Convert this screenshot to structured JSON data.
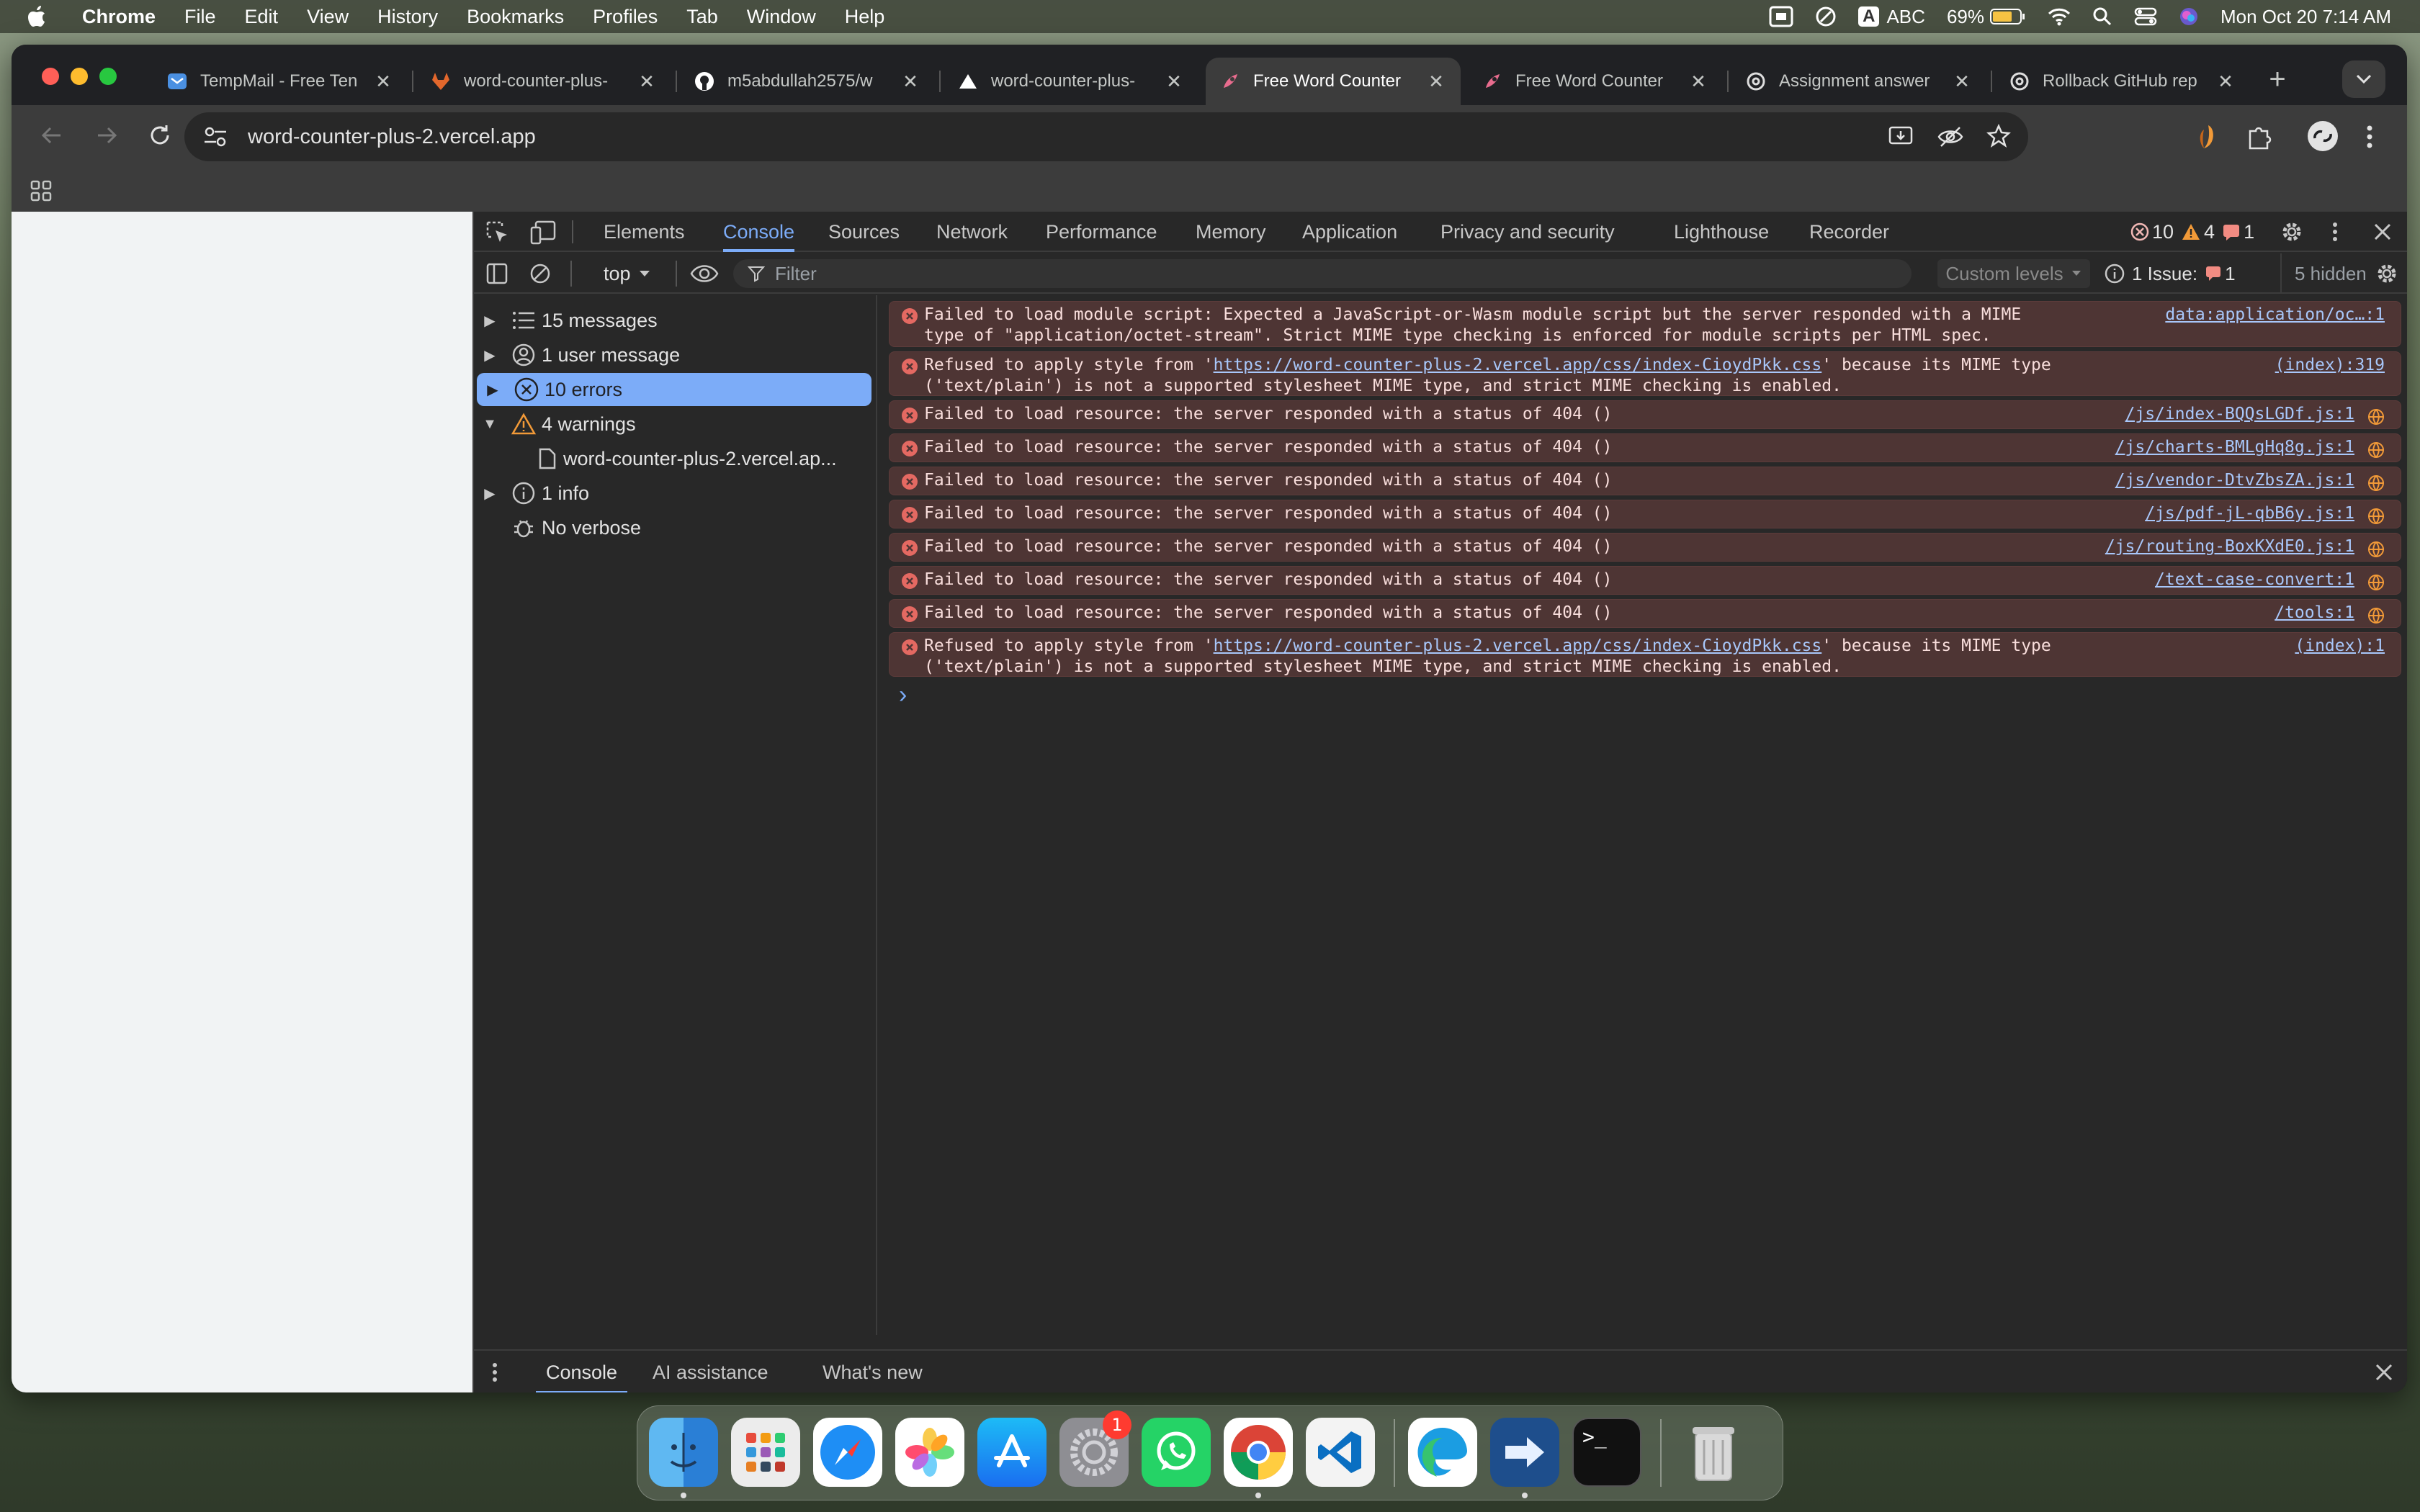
{
  "menubar": {
    "app_name": "Chrome",
    "items": [
      "File",
      "Edit",
      "View",
      "History",
      "Bookmarks",
      "Profiles",
      "Tab",
      "Window",
      "Help"
    ],
    "input_source": "ABC",
    "input_letter": "A",
    "battery": "69%",
    "datetime": "Mon Oct 20  7:14 AM"
  },
  "tabs": [
    {
      "title": "TempMail - Free Ten",
      "icon": "mail-icon",
      "color": "#4a90e2"
    },
    {
      "title": "word-counter-plus-",
      "icon": "gitlab-icon",
      "color": "#e2672c"
    },
    {
      "title": "m5abdullah2575/w",
      "icon": "github-icon",
      "color": "#ffffff"
    },
    {
      "title": "word-counter-plus-",
      "icon": "vercel-icon",
      "color": "#ffffff"
    },
    {
      "title": "Free Word Counter",
      "icon": "rocket-icon",
      "color": "#e86c8e",
      "active": true
    },
    {
      "title": "Free Word Counter",
      "icon": "rocket-icon",
      "color": "#e86c8e"
    },
    {
      "title": "Assignment answer",
      "icon": "openai-icon",
      "color": "#dddddd"
    },
    {
      "title": "Rollback GitHub rep",
      "icon": "openai-icon",
      "color": "#dddddd"
    }
  ],
  "address_bar": {
    "url": "word-counter-plus-2.vercel.app"
  },
  "devtools": {
    "tabs": [
      "Elements",
      "Console",
      "Sources",
      "Network",
      "Performance",
      "Memory",
      "Application",
      "Privacy and security",
      "Lighthouse",
      "Recorder"
    ],
    "active_tab": "Console",
    "counts": {
      "errors": "10",
      "warnings": "4",
      "issues": "1"
    },
    "context": "top",
    "filter_placeholder": "Filter",
    "levels": "Custom levels",
    "issues_label": "1 Issue:",
    "issues_count": "1",
    "hidden": "5 hidden",
    "sidebar": [
      {
        "label": "15 messages",
        "icon": "list-icon",
        "expand": "right"
      },
      {
        "label": "1 user message",
        "icon": "user-icon",
        "expand": "right"
      },
      {
        "label": "10 errors",
        "icon": "error-icon",
        "expand": "right",
        "selected": true
      },
      {
        "label": "4 warnings",
        "icon": "warning-icon",
        "expand": "down"
      },
      {
        "label": "word-counter-plus-2.vercel.ap...",
        "icon": "file-icon",
        "expand": "none",
        "child": true
      },
      {
        "label": "1 info",
        "icon": "info-icon",
        "expand": "right"
      },
      {
        "label": "No verbose",
        "icon": "bug-icon",
        "expand": "none"
      }
    ],
    "messages": [
      {
        "line1": "Failed to load module script: Expected a JavaScript-or-Wasm module script but the server responded with a MIME",
        "line2": "type of \"application/octet-stream\". Strict MIME type checking is enforced for module scripts per HTML spec.",
        "source": "data:application/oc…:1"
      },
      {
        "prefix": "Refused to apply style from '",
        "link": "https://word-counter-plus-2.vercel.app/css/index-CioydPkk.css",
        "suffix": "' because its MIME type",
        "line2": "('text/plain') is not a supported stylesheet MIME type, and strict MIME checking is enabled.",
        "source": "(index):319"
      },
      {
        "line1": "Failed to load resource: the server responded with a status of 404 ()",
        "source": "/js/index-BQQsLGDf.js:1"
      },
      {
        "line1": "Failed to load resource: the server responded with a status of 404 ()",
        "source": "/js/charts-BMLgHq8g.js:1"
      },
      {
        "line1": "Failed to load resource: the server responded with a status of 404 ()",
        "source": "/js/vendor-DtvZbsZA.js:1"
      },
      {
        "line1": "Failed to load resource: the server responded with a status of 404 ()",
        "source": "/js/pdf-jL-qbB6y.js:1"
      },
      {
        "line1": "Failed to load resource: the server responded with a status of 404 ()",
        "source": "/js/routing-BoxKXdE0.js:1"
      },
      {
        "line1": "Failed to load resource: the server responded with a status of 404 ()",
        "source": "/text-case-convert:1"
      },
      {
        "line1": "Failed to load resource: the server responded with a status of 404 ()",
        "source": "/tools:1"
      },
      {
        "prefix": "Refused to apply style from '",
        "link": "https://word-counter-plus-2.vercel.app/css/index-CioydPkk.css",
        "suffix": "' because its MIME type",
        "line2": "('text/plain') is not a supported stylesheet MIME type, and strict MIME checking is enabled.",
        "source": "(index):1"
      }
    ],
    "prompt": "›",
    "drawer": [
      "Console",
      "AI assistance",
      "What's new"
    ]
  },
  "dock": {
    "apps": [
      "finder-icon",
      "launchpad-icon",
      "safari-icon",
      "photos-icon",
      "app-store-icon",
      "system-settings-icon",
      "whatsapp-icon",
      "chrome-icon",
      "vscode-icon",
      "edge-icon",
      "migration-icon",
      "terminal-icon",
      "trash-icon"
    ],
    "settings_badge": "1",
    "terminal_label": ">_"
  },
  "colors": {
    "error_bg": "#4e3534",
    "accent": "#7cacf8",
    "selected": "#7cacf8"
  }
}
